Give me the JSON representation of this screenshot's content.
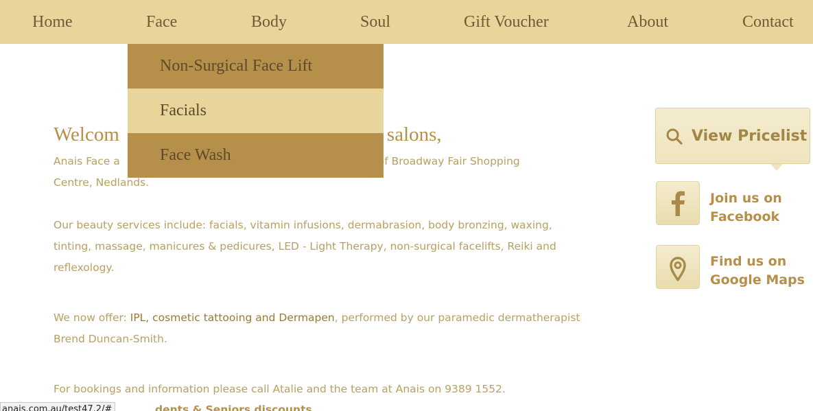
{
  "nav": {
    "items": [
      {
        "label": "Home"
      },
      {
        "label": "Face"
      },
      {
        "label": "Body"
      },
      {
        "label": "Soul"
      },
      {
        "label": "Gift Voucher"
      },
      {
        "label": "About"
      },
      {
        "label": "Contact"
      }
    ]
  },
  "dropdown": {
    "items": [
      {
        "label": "Non-Surgical Face Lift"
      },
      {
        "label": "Facials"
      },
      {
        "label": "Face Wash"
      }
    ]
  },
  "content": {
    "welcome_visible": "Welcom",
    "welcome_tail": "salons,",
    "intro_left_visible": "Anais Face a",
    "intro_right_visible": "of Broadway Fair Shopping",
    "intro_line2": "Centre, Nedlands.",
    "services": "Our beauty services include: facials, vitamin infusions, dermabrasion, body bronzing, waxing, tinting, massage, manicures & pedicures, LED - Light Therapy, non-surgical facelifts, Reiki and reflexology.",
    "offer_prefix": "We now offer: ",
    "offer_highlight": "IPL, cosmetic tattooing and Dermapen",
    "offer_suffix": ", performed by our paramedic dermatherapist Brend Duncan-Smith.",
    "bookings": "For bookings and information please call Atalie and the team at Anais on 9389 1552.",
    "bottom_link_visible": "dents & Seniors discounts"
  },
  "sidebar": {
    "pricelist_label": "View Pricelist",
    "facebook_line1": "Join us on",
    "facebook_line2": "Facebook",
    "maps_line1": "Find us on",
    "maps_line2": "Google Maps",
    "icons": [
      "search-icon",
      "facebook-icon",
      "map-pin-icon"
    ]
  },
  "status_bar": {
    "url": "anais.com.au/test47.2/#"
  },
  "colors": {
    "nav_bg": "#e8d59c",
    "dropdown_dark": "#b68f4a",
    "dropdown_light": "#e8d59c",
    "accent_text": "#b68f4a",
    "body_text": "#b8a062"
  }
}
